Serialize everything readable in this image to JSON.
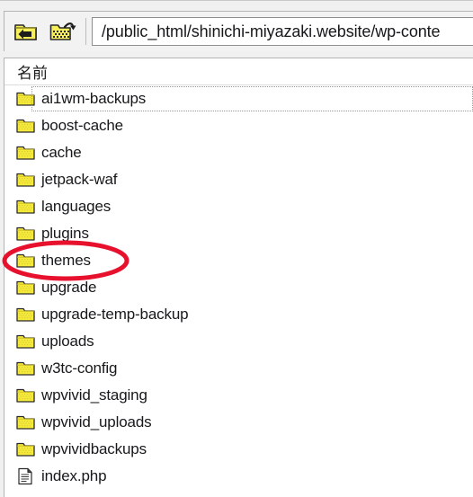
{
  "toolbar": {
    "up_button": {
      "icon": "folder-up-icon",
      "title": "上のディレクトリへ"
    },
    "refresh_button": {
      "icon": "folder-refresh-icon",
      "title": "更新"
    },
    "path": {
      "value": "/public_html/shinichi-miyazaki.website/wp-conte",
      "placeholder": ""
    }
  },
  "list": {
    "columns": [
      {
        "label": "名前"
      }
    ],
    "items": [
      {
        "name": "ai1wm-backups",
        "icon": "folder-icon",
        "type": "folder",
        "focused": true,
        "annotated": false
      },
      {
        "name": "boost-cache",
        "icon": "folder-icon",
        "type": "folder",
        "focused": false,
        "annotated": false
      },
      {
        "name": "cache",
        "icon": "folder-icon",
        "type": "folder",
        "focused": false,
        "annotated": false
      },
      {
        "name": "jetpack-waf",
        "icon": "folder-icon",
        "type": "folder",
        "focused": false,
        "annotated": false
      },
      {
        "name": "languages",
        "icon": "folder-icon",
        "type": "folder",
        "focused": false,
        "annotated": false
      },
      {
        "name": "plugins",
        "icon": "folder-icon",
        "type": "folder",
        "focused": false,
        "annotated": false
      },
      {
        "name": "themes",
        "icon": "folder-icon",
        "type": "folder",
        "focused": false,
        "annotated": true
      },
      {
        "name": "upgrade",
        "icon": "folder-icon",
        "type": "folder",
        "focused": false,
        "annotated": false
      },
      {
        "name": "upgrade-temp-backup",
        "icon": "folder-icon",
        "type": "folder",
        "focused": false,
        "annotated": false
      },
      {
        "name": "uploads",
        "icon": "folder-icon",
        "type": "folder",
        "focused": false,
        "annotated": false
      },
      {
        "name": "w3tc-config",
        "icon": "folder-icon",
        "type": "folder",
        "focused": false,
        "annotated": false
      },
      {
        "name": "wpvivid_staging",
        "icon": "folder-icon",
        "type": "folder",
        "focused": false,
        "annotated": false
      },
      {
        "name": "wpvivid_uploads",
        "icon": "folder-icon",
        "type": "folder",
        "focused": false,
        "annotated": false
      },
      {
        "name": "wpvividbackups",
        "icon": "folder-icon",
        "type": "folder",
        "focused": false,
        "annotated": false
      },
      {
        "name": "index.php",
        "icon": "document-icon",
        "type": "file",
        "focused": false,
        "annotated": false
      }
    ]
  },
  "annotation": {
    "shape": "ellipse",
    "target": "themes",
    "color": "#e8112d",
    "stroke_width": 5
  },
  "colors": {
    "accent_red": "#e8112d",
    "folder_yellow": "#f5e93c",
    "folder_outline": "#2b2b2b",
    "panel_background": "#ffffff",
    "chrome_background": "#f0f0f0",
    "text": "#17181a"
  }
}
